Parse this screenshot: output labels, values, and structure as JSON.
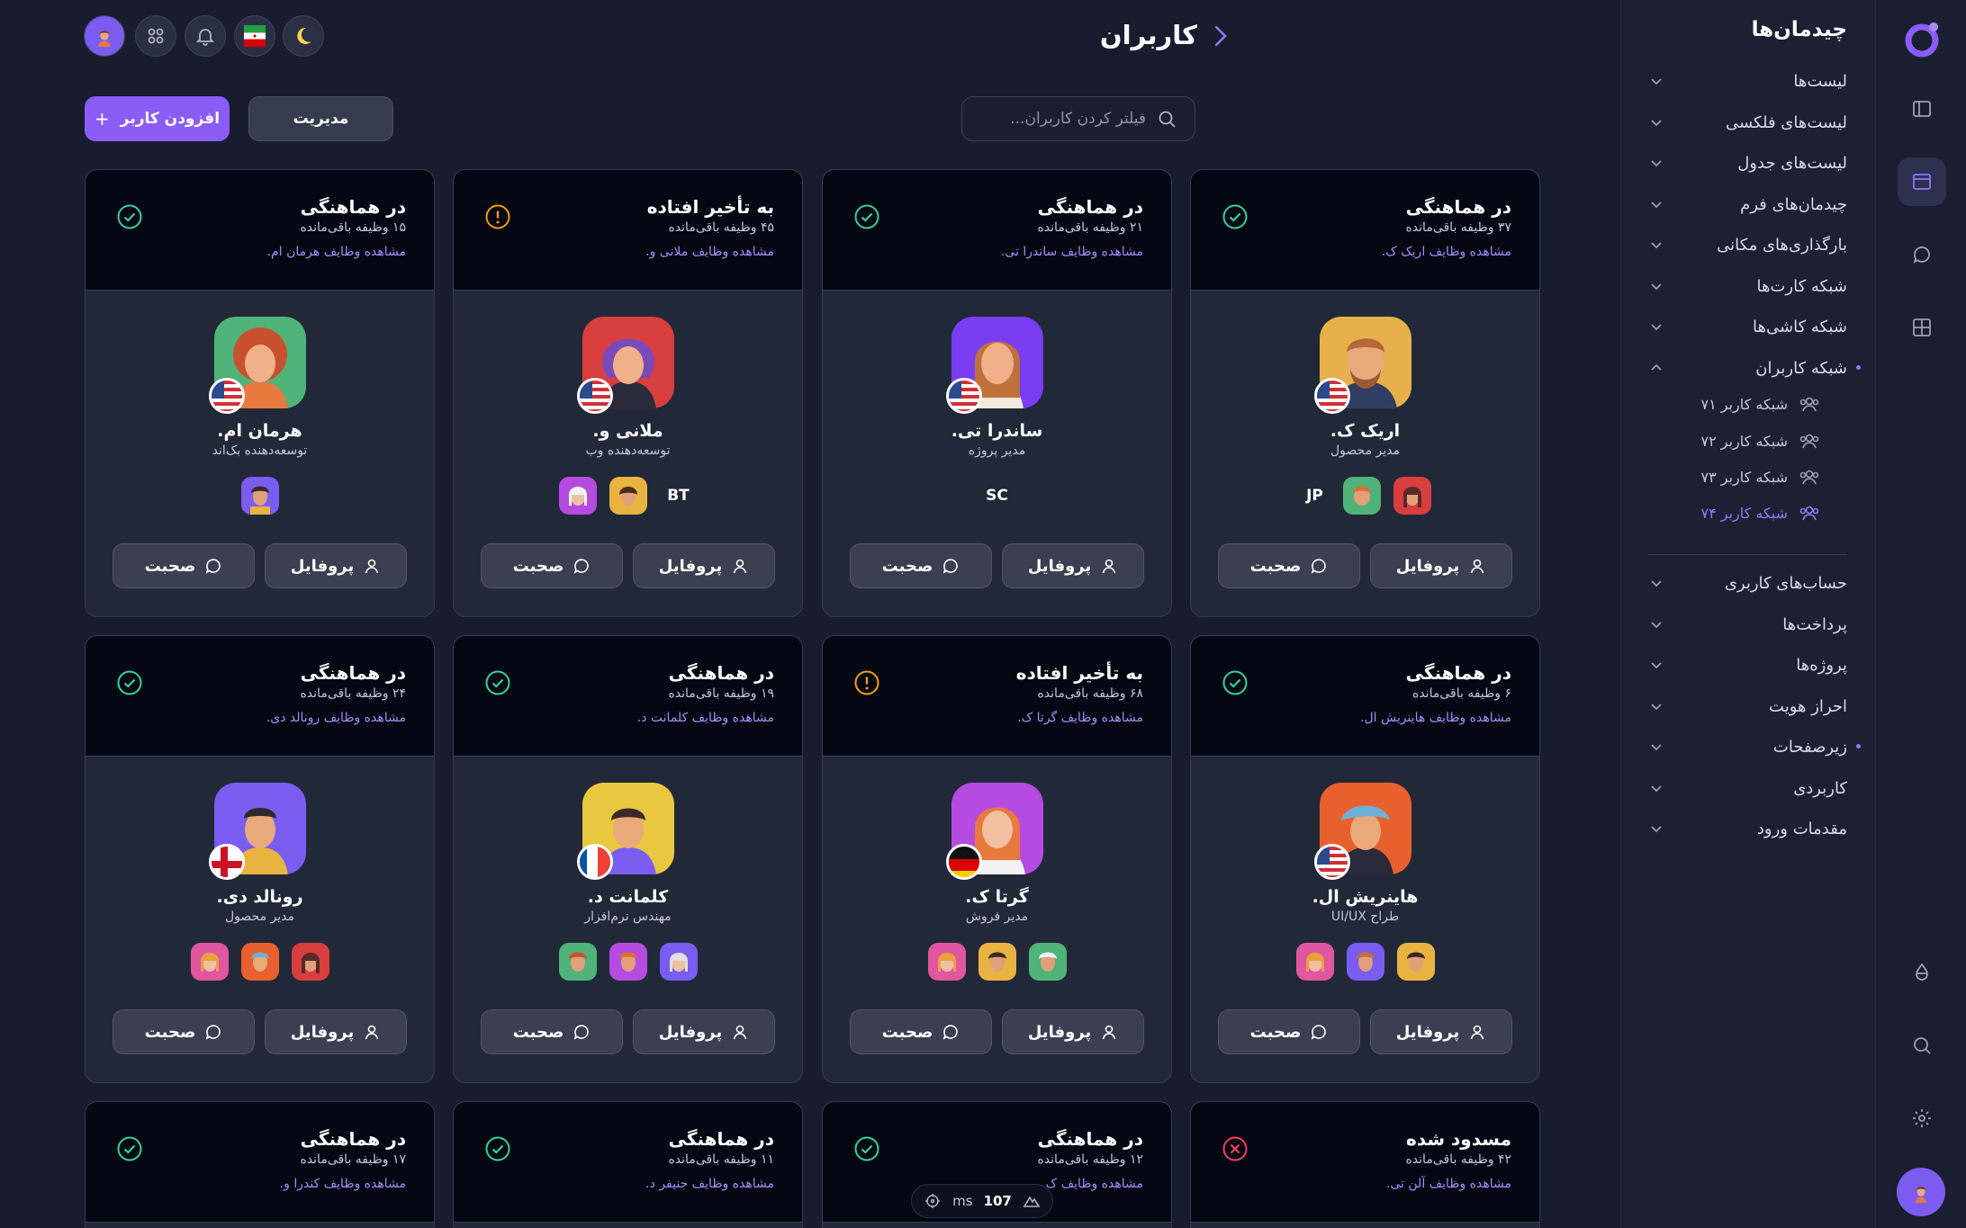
{
  "sidebar": {
    "title": "چیدمان‌ها",
    "items": [
      {
        "label": "لیست‌ها"
      },
      {
        "label": "لیست‌های فلکسی"
      },
      {
        "label": "لیست‌های جدول"
      },
      {
        "label": "چیدمان‌های فرم"
      },
      {
        "label": "بارگذاری‌های مکانی"
      },
      {
        "label": "شبکه کارت‌ها"
      },
      {
        "label": "شبکه کاشی‌ها"
      },
      {
        "label": "شبکه کاربران"
      }
    ],
    "subitems": [
      {
        "label": "شبکه کاربر ۷۱"
      },
      {
        "label": "شبکه کاربر ۷۲"
      },
      {
        "label": "شبکه کاربر ۷۳"
      },
      {
        "label": "شبکه کاربر ۷۴"
      }
    ],
    "items2": [
      {
        "label": "حساب‌های کاربری"
      },
      {
        "label": "پرداخت‌ها"
      },
      {
        "label": "پروژه‌ها"
      },
      {
        "label": "احراز هویت"
      },
      {
        "label": "زیرصفحات"
      },
      {
        "label": "کاربردی"
      },
      {
        "label": "مقدمات ورود"
      }
    ]
  },
  "header": {
    "title": "کاربران",
    "search_placeholder": "فیلتر کردن کاربران...",
    "manage_label": "مدیریت",
    "add_label": "افزودن کاربر"
  },
  "card_labels": {
    "profile": "پروفایل",
    "chat": "صحبت"
  },
  "cards": [
    {
      "status": "در هماهنگی",
      "tasks": "۳۷ وظیفه باقی‌مانده",
      "link": "مشاهده وظایف اریک ک.",
      "name": "اریک ک.",
      "role": "مدیر محصول",
      "team": [
        "JP"
      ]
    },
    {
      "status": "در هماهنگی",
      "tasks": "۲۱ وظیفه باقی‌مانده",
      "link": "مشاهده وظایف ساندرا تی.",
      "name": "ساندرا تی.",
      "role": "مدیر پروژه",
      "team": [
        "SC"
      ]
    },
    {
      "status": "به تأخیر افتاده",
      "tasks": "۴۵ وظیفه باقی‌مانده",
      "link": "مشاهده وظایف ملانی و.",
      "name": "ملانی و.",
      "role": "توسعه‌دهنده وب",
      "team": [
        "BT"
      ]
    },
    {
      "status": "در هماهنگی",
      "tasks": "۱۵ وظیفه باقی‌مانده",
      "link": "مشاهده وظایف هرمان ام.",
      "name": "هرمان ام.",
      "role": "توسعه‌دهنده بک‌اند",
      "team": []
    },
    {
      "status": "در هماهنگی",
      "tasks": "۶ وظیفه باقی‌مانده",
      "link": "مشاهده وظایف هاینریش ال.",
      "name": "هاینریش ال.",
      "role": "طراح UI/UX",
      "team": []
    },
    {
      "status": "به تأخیر افتاده",
      "tasks": "۶۸ وظیفه باقی‌مانده",
      "link": "مشاهده وظایف گرتا ک.",
      "name": "گرتا ک.",
      "role": "مدیر فروش",
      "team": []
    },
    {
      "status": "در هماهنگی",
      "tasks": "۱۹ وظیفه باقی‌مانده",
      "link": "مشاهده وظایف کلمانت د.",
      "name": "کلمانت د.",
      "role": "مهندس نرم‌افزار",
      "team": []
    },
    {
      "status": "در هماهنگی",
      "tasks": "۲۴ وظیفه باقی‌مانده",
      "link": "مشاهده وظایف رونالد دی.",
      "name": "رونالد دی.",
      "role": "مدیر محصول",
      "team": []
    },
    {
      "status": "مسدود شده",
      "tasks": "۴۲ وظیفه باقی‌مانده",
      "link": "مشاهده وظایف آلن تی.",
      "name": "",
      "role": "",
      "team": []
    },
    {
      "status": "در هماهنگی",
      "tasks": "۱۲ وظیفه باقی‌مانده",
      "link": "مشاهده وظایف ک...",
      "name": "",
      "role": "",
      "team": []
    },
    {
      "status": "در هماهنگی",
      "tasks": "۱۱ وظیفه باقی‌مانده",
      "link": "مشاهده وظایف جنیفر د.",
      "name": "",
      "role": "",
      "team": []
    },
    {
      "status": "در هماهنگی",
      "tasks": "۱۷ وظیفه باقی‌مانده",
      "link": "مشاهده وظایف کندرا و.",
      "name": "",
      "role": "",
      "team": []
    }
  ],
  "overlay": {
    "value": "107",
    "unit": "ms"
  },
  "colors": {
    "accent": "#8b5cf6",
    "ok": "#34d399",
    "warn": "#f59e0b",
    "error": "#f43f5e"
  }
}
